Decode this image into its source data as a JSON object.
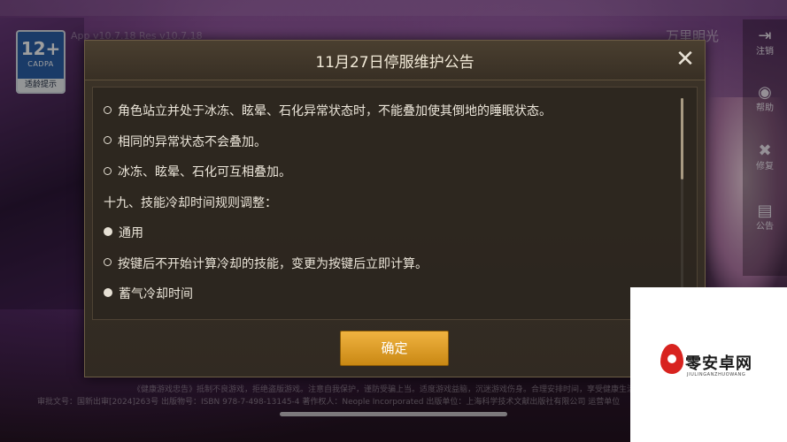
{
  "background": {
    "version_text": "App v10.7.18 Res v10.7.18",
    "brand_text": "万里明光",
    "age_rating": {
      "number": "12+",
      "org": "CADPA",
      "tip": "适龄提示"
    },
    "side_menu": [
      {
        "icon": "logout-icon",
        "label": "注销"
      },
      {
        "icon": "help-icon",
        "label": "帮助"
      },
      {
        "icon": "repair-icon",
        "label": "修复"
      },
      {
        "icon": "notice-icon",
        "label": "公告"
      }
    ],
    "footer_lines": [
      "《健康游戏忠告》抵制不良游戏，拒绝盗版游戏。注意自我保护，谨防受骗上当。适度游戏益脑，沉迷游戏伤身。合理安排时间，享受健康生活。",
      "审批文号：国新出审[2024]263号  出版物号：ISBN 978-7-498-13145-4  著作权人：Neople Incorporated  出版单位：上海科学技术文献出版社有限公司  运营单位"
    ]
  },
  "dialog": {
    "title": "11月27日停服维护公告",
    "lines": [
      {
        "bullet": "open",
        "text": "角色站立并处于冰冻、眩晕、石化异常状态时，不能叠加使其倒地的睡眠状态。"
      },
      {
        "bullet": "open",
        "text": "相同的异常状态不会叠加。"
      },
      {
        "bullet": "open",
        "text": "冰冻、眩晕、石化可互相叠加。"
      },
      {
        "bullet": "none",
        "text": "十九、技能冷却时间规则调整："
      },
      {
        "bullet": "filled",
        "text": "通用"
      },
      {
        "bullet": "open",
        "text": "按键后不开始计算冷却的技能，变更为按键后立即计算。"
      },
      {
        "bullet": "filled",
        "text": "蓄气冷却时间"
      }
    ],
    "confirm_label": "确定",
    "close_icon": "close-icon"
  },
  "watermark": {
    "title": "零安卓网",
    "subtitle": "JIULINGANZHUOWANG"
  },
  "colors": {
    "confirm_button": "#e0a12c",
    "dialog_bg": "#352d24"
  }
}
